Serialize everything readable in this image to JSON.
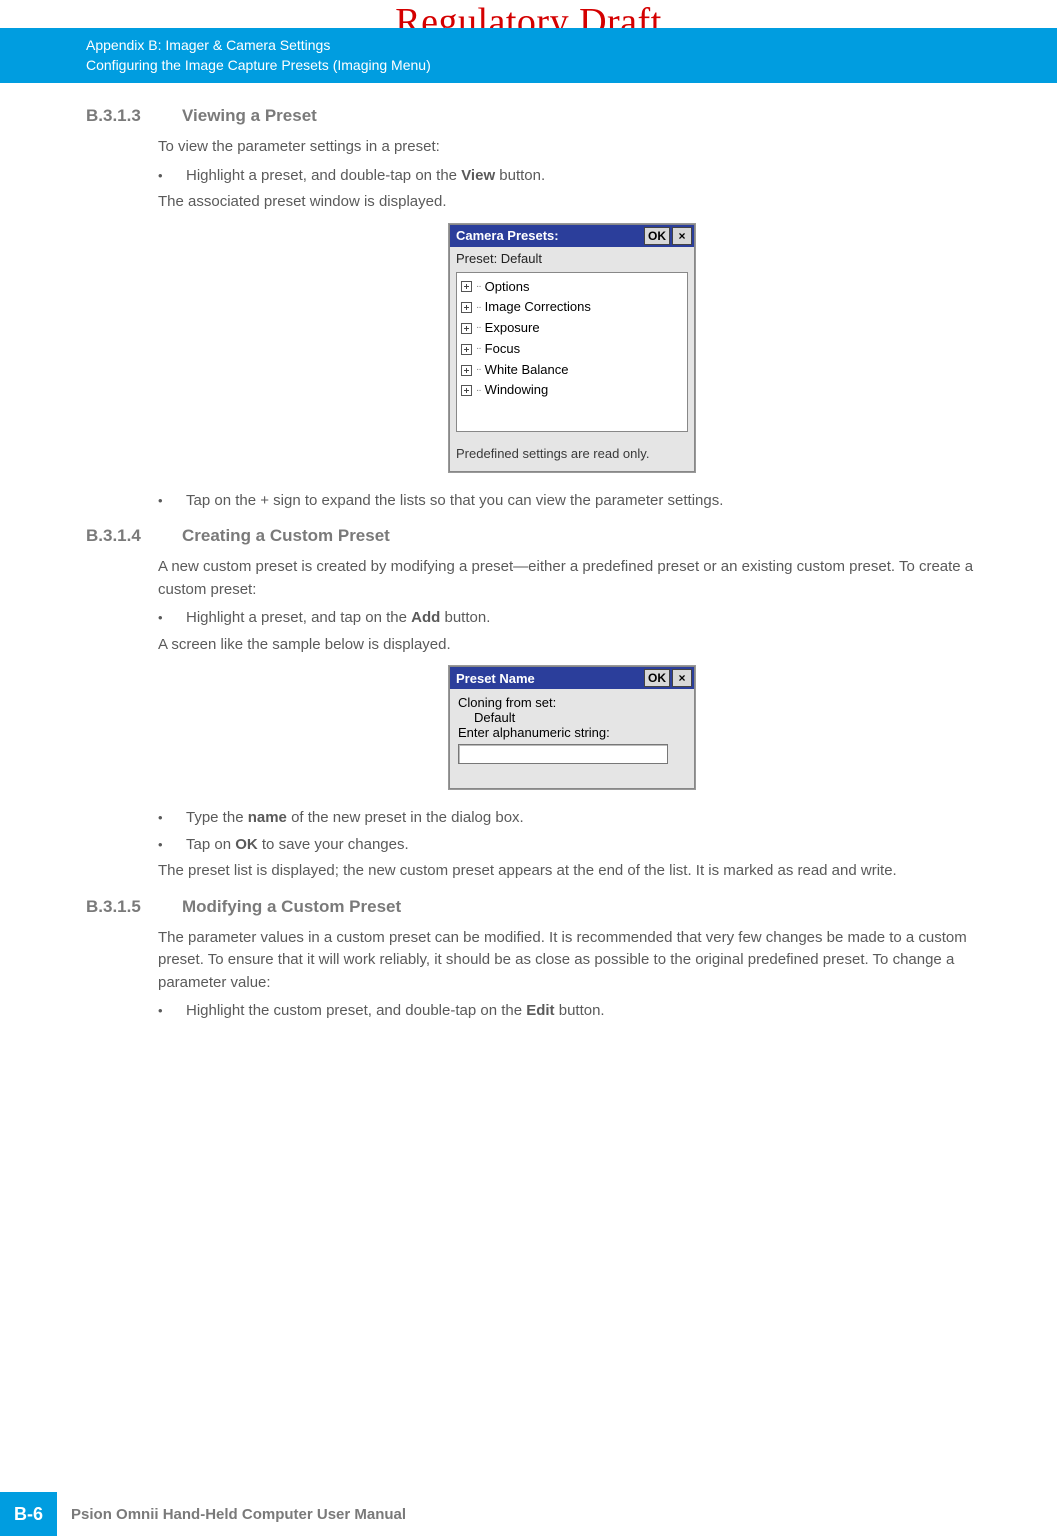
{
  "watermark": "Regulatory Draft",
  "header": {
    "line1": "Appendix B: Imager & Camera Settings",
    "line2": "Configuring the Image Capture Presets (Imaging Menu)"
  },
  "sections": {
    "s1": {
      "num": "B.3.1.3",
      "title": "Viewing a Preset",
      "p1": "To view the parameter settings in a preset:",
      "b1a": "Highlight a preset, and double-tap on the ",
      "b1b_bold": "View",
      "b1c": " button.",
      "p2": "The associated preset window is displayed.",
      "b2": "Tap on the + sign to expand the lists so that you can view the parameter settings."
    },
    "s2": {
      "num": "B.3.1.4",
      "title": "Creating a Custom Preset",
      "p1": "A new custom preset is created by modifying a preset—either a predefined preset or an existing custom preset. To create a custom preset:",
      "b1a": "Highlight a preset, and tap on the ",
      "b1b_bold": "Add",
      "b1c": " button.",
      "p2": "A screen like the sample below is displayed.",
      "b2a": "Type the ",
      "b2b_bold": "name",
      "b2c": " of the new preset in the dialog box.",
      "b3a": "Tap on ",
      "b3b_bold": "OK",
      "b3c": " to save your changes.",
      "p3": "The preset list is displayed; the new custom preset appears at the end of the list. It is marked as read and write."
    },
    "s3": {
      "num": "B.3.1.5",
      "title": "Modifying a Custom Preset",
      "p1": "The parameter values in a custom preset can be modified. It is recommended that very few changes be made to a custom preset. To ensure that it will work reliably, it should be as close as possible to the original predefined preset. To change a parameter value:",
      "b1a": "Highlight the custom preset, and double-tap on the ",
      "b1b_bold": "Edit",
      "b1c": " button."
    }
  },
  "dialog1": {
    "title": "Camera Presets:",
    "ok": "OK",
    "close": "×",
    "preset_label": "Preset: Default",
    "tree": [
      "Options",
      "Image Corrections",
      "Exposure",
      "Focus",
      "White Balance",
      "Windowing"
    ],
    "note": "Predefined settings are read only."
  },
  "dialog2": {
    "title": "Preset Name",
    "ok": "OK",
    "close": "×",
    "line1": "Cloning from set:",
    "line2": "Default",
    "line3": "Enter alphanumeric string:"
  },
  "footer": {
    "page": "B-6",
    "text": "Psion Omnii Hand-Held Computer User Manual"
  }
}
